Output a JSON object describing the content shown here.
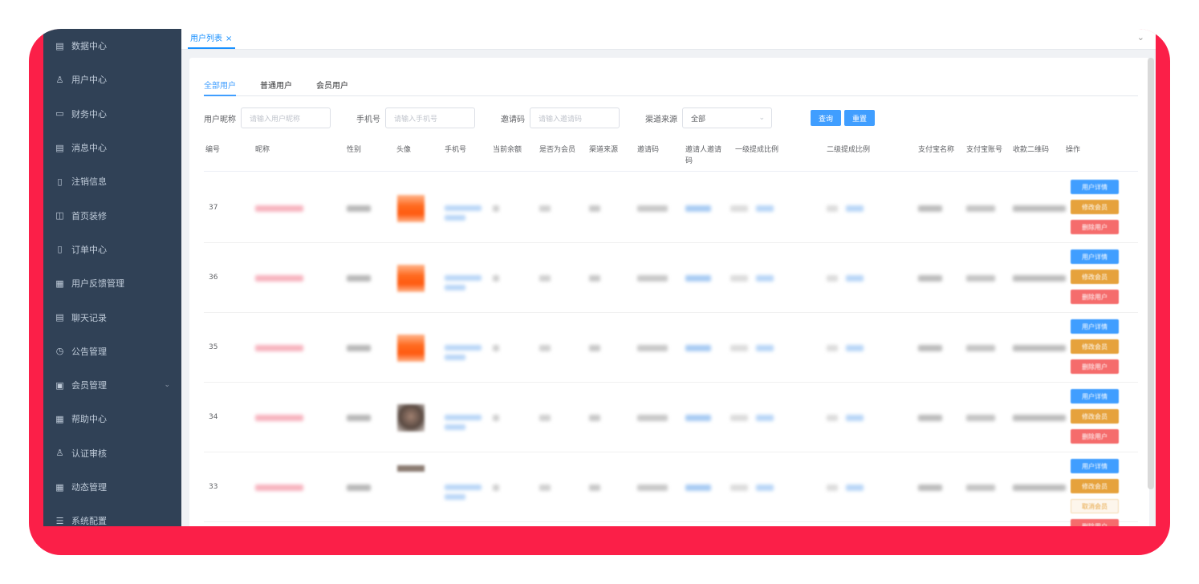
{
  "sidebar": {
    "items": [
      {
        "label": "数据中心",
        "icon": "document-icon"
      },
      {
        "label": "用户中心",
        "icon": "user-icon"
      },
      {
        "label": "财务中心",
        "icon": "wallet-icon"
      },
      {
        "label": "消息中心",
        "icon": "message-icon"
      },
      {
        "label": "注销信息",
        "icon": "clipboard-icon"
      },
      {
        "label": "首页装修",
        "icon": "box-icon"
      },
      {
        "label": "订单中心",
        "icon": "order-icon"
      },
      {
        "label": "用户反馈管理",
        "icon": "list-icon"
      },
      {
        "label": "聊天记录",
        "icon": "chat-icon"
      },
      {
        "label": "公告管理",
        "icon": "clock-icon"
      },
      {
        "label": "会员管理",
        "icon": "member-icon",
        "expandable": true
      },
      {
        "label": "帮助中心",
        "icon": "help-icon"
      },
      {
        "label": "认证审核",
        "icon": "user-check-icon"
      },
      {
        "label": "动态管理",
        "icon": "grid-icon"
      },
      {
        "label": "系统配置",
        "icon": "settings-list-icon"
      }
    ]
  },
  "tagsbar": {
    "active_tag": "用户列表",
    "close": "×",
    "menu": "⌄"
  },
  "tabs": [
    {
      "label": "全部用户",
      "active": true
    },
    {
      "label": "普通用户",
      "active": false
    },
    {
      "label": "会员用户",
      "active": false
    }
  ],
  "filters": {
    "nickname_label": "用户昵称",
    "nickname_placeholder": "请输入用户昵称",
    "phone_label": "手机号",
    "phone_placeholder": "请输入手机号",
    "invite_label": "邀请码",
    "invite_placeholder": "请输入邀请码",
    "channel_label": "渠道来源",
    "channel_value": "全部",
    "search_button": "查询",
    "reset_button": "重置"
  },
  "table": {
    "headers": [
      "编号",
      "昵称",
      "性别",
      "头像",
      "手机号",
      "当前余额",
      "是否为会员",
      "渠道来源",
      "邀请码",
      "邀请人邀请码",
      "一级提成比例",
      "二级提成比例",
      "支付宝名称",
      "支付宝账号",
      "收款二维码",
      "操作"
    ],
    "rows": [
      {
        "id": "37",
        "avatar": "orange",
        "actions": [
          "用户详情",
          "修改会员",
          "删除用户"
        ]
      },
      {
        "id": "36",
        "avatar": "orange",
        "actions": [
          "用户详情",
          "修改会员",
          "删除用户"
        ]
      },
      {
        "id": "35",
        "avatar": "orange",
        "actions": [
          "用户详情",
          "修改会员",
          "删除用户"
        ]
      },
      {
        "id": "34",
        "avatar": "photo",
        "actions": [
          "用户详情",
          "修改会员",
          "删除用户"
        ]
      },
      {
        "id": "33",
        "avatar": "photo-small",
        "actions": [
          "用户详情",
          "修改会员",
          "取消会员",
          "删除用户"
        ]
      }
    ]
  },
  "colors": {
    "sidebar_bg": "#304156",
    "primary": "#409eff",
    "warning": "#e6a23c",
    "danger": "#f56c6c",
    "frame": "#fb1f48"
  }
}
